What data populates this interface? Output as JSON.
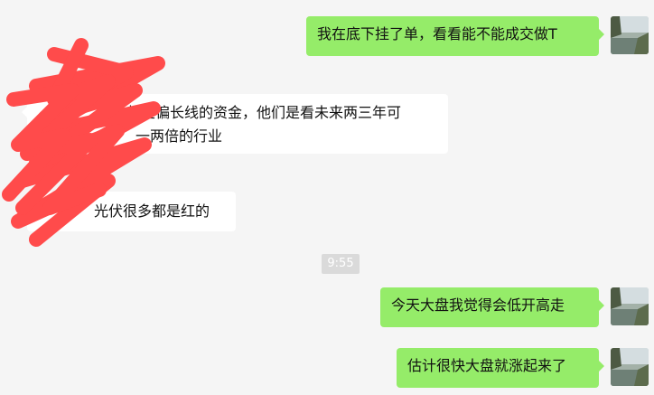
{
  "chat": {
    "messages_right_top": [
      "我在底下挂了单，看看能不能成交做T"
    ],
    "left_message_1": {
      "line1": "都是偏长线的资金，他们是看未来两三年可",
      "line2": "一两倍的行业"
    },
    "left_message_2": "光伏很多都是红的",
    "timestamp": "9:55",
    "messages_right_bottom": [
      "今天大盘我觉得会低开高走",
      "估计很快大盘就涨起来了"
    ]
  },
  "colors": {
    "background": "#f5f5f5",
    "outgoing_bubble": "#95ec69",
    "incoming_bubble": "#ffffff",
    "redaction": "#ff4b4b"
  },
  "icons": {
    "avatar": "lake-landscape-avatar"
  }
}
